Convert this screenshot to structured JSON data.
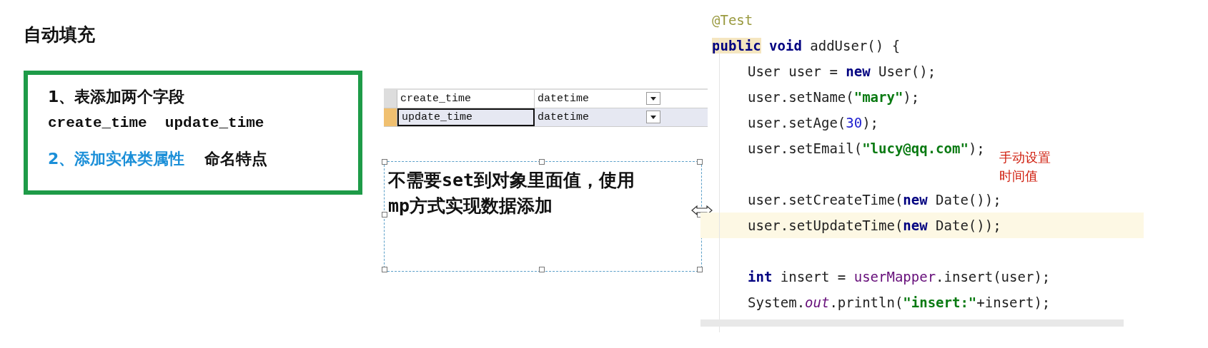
{
  "title": "自动填充",
  "notes": [
    {
      "kind": "plain",
      "text": "1、表添加两个字段"
    },
    {
      "kind": "mono",
      "text": "create_time  update_time"
    },
    {
      "kind": "split",
      "text": "2、添加实体类属性",
      "aside": "命名特点"
    }
  ],
  "table": {
    "rows": [
      {
        "name": "create_time",
        "type": "datetime",
        "selected": false
      },
      {
        "name": "update_time",
        "type": "datetime",
        "selected": true
      }
    ]
  },
  "text_box": {
    "text": "不需要set到对象里面值，使用mp方式实现数据添加"
  },
  "code": {
    "lines": [
      {
        "kind": "code",
        "indent": false,
        "highlighted": false,
        "tokens": [
          {
            "kind": "annotation",
            "text": "@Test"
          }
        ]
      },
      {
        "kind": "code",
        "indent": false,
        "highlighted": false,
        "tokens": [
          {
            "kind": "keyword-match",
            "text": "public"
          },
          {
            "kind": "keyword",
            "text": " void"
          },
          {
            "kind": "plain",
            "text": " addUser() {"
          }
        ]
      },
      {
        "kind": "code",
        "indent": true,
        "highlighted": false,
        "tokens": [
          {
            "kind": "plain",
            "text": "User user = "
          },
          {
            "kind": "keyword",
            "text": "new"
          },
          {
            "kind": "plain",
            "text": " User();"
          }
        ]
      },
      {
        "kind": "code",
        "indent": true,
        "highlighted": false,
        "tokens": [
          {
            "kind": "plain",
            "text": "user.setName("
          },
          {
            "kind": "string",
            "text": "\"mary\""
          },
          {
            "kind": "plain",
            "text": ");"
          }
        ]
      },
      {
        "kind": "code",
        "indent": true,
        "highlighted": false,
        "tokens": [
          {
            "kind": "plain",
            "text": "user.setAge("
          },
          {
            "kind": "number",
            "text": "30"
          },
          {
            "kind": "plain",
            "text": ");"
          }
        ]
      },
      {
        "kind": "code",
        "indent": true,
        "highlighted": false,
        "tokens": [
          {
            "kind": "plain",
            "text": "user.setEmail("
          },
          {
            "kind": "string",
            "text": "\"lucy@qq.com\""
          },
          {
            "kind": "plain",
            "text": ");"
          }
        ]
      },
      {
        "kind": "blank"
      },
      {
        "kind": "code",
        "indent": true,
        "highlighted": false,
        "tokens": [
          {
            "kind": "plain",
            "text": "user.setCreateTime("
          },
          {
            "kind": "keyword",
            "text": "new"
          },
          {
            "kind": "plain",
            "text": " Date());"
          }
        ]
      },
      {
        "kind": "code",
        "indent": true,
        "highlighted": true,
        "tokens": [
          {
            "kind": "plain",
            "text": "user.setUpdateTime("
          },
          {
            "kind": "keyword",
            "text": "new"
          },
          {
            "kind": "plain",
            "text": " Date());"
          }
        ]
      },
      {
        "kind": "blank"
      },
      {
        "kind": "code",
        "indent": true,
        "highlighted": false,
        "tokens": [
          {
            "kind": "keyword",
            "text": "int"
          },
          {
            "kind": "plain",
            "text": " insert = "
          },
          {
            "kind": "field",
            "text": "userMapper"
          },
          {
            "kind": "plain",
            "text": ".insert(user);"
          }
        ]
      },
      {
        "kind": "code",
        "indent": true,
        "highlighted": false,
        "tokens": [
          {
            "kind": "plain",
            "text": "System."
          },
          {
            "kind": "static",
            "text": "out"
          },
          {
            "kind": "plain",
            "text": ".println("
          },
          {
            "kind": "string",
            "text": "\"insert:\""
          },
          {
            "kind": "plain",
            "text": "+insert);"
          }
        ]
      }
    ],
    "comment": [
      "手动设置",
      "时间值"
    ]
  }
}
